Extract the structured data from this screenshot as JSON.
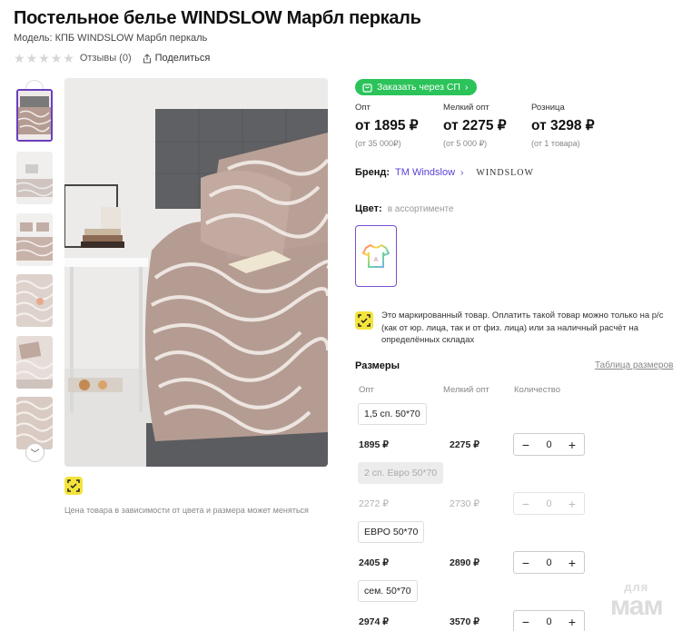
{
  "product": {
    "title": "Постельное белье WINDSLOW Марбл перкаль",
    "model": "Модель: КПБ WINDSLOW Марбл перкаль",
    "reviews": "Отзывы (0)",
    "share": "Поделиться",
    "rating_stars": 5,
    "price_note": "Цена товара в зависимости от цвета и размера может меняться"
  },
  "sp_button": "Заказать через СП",
  "prices": [
    {
      "label": "Опт",
      "value": "от 1895 ₽",
      "min": "(от 35 000₽)"
    },
    {
      "label": "Мелкий опт",
      "value": "от 2275 ₽",
      "min": "(от 5 000 ₽)"
    },
    {
      "label": "Розница",
      "value": "от 3298 ₽",
      "min": "(от 1 товара)"
    }
  ],
  "brand": {
    "label": "Бренд:",
    "name": "TM Windslow",
    "logo_text": "WINDSLOW"
  },
  "color": {
    "label": "Цвет:",
    "value": "в ассортименте"
  },
  "marked_text": "Это маркированный товар. Оплатить такой товар можно только на р/с (как от юр. лица, так и от физ. лица) или за наличный расчёт на определённых складах",
  "sizes": {
    "title": "Размеры",
    "table_link": "Таблица размеров",
    "col_opt": "Опт",
    "col_small_opt": "Мелкий опт",
    "col_qty": "Количество",
    "rows": [
      {
        "name": "1,5 сп. 50*70",
        "opt": "1895 ₽",
        "small_opt": "2275 ₽",
        "qty": "0",
        "disabled": false
      },
      {
        "name": "2 сп. Евро 50*70",
        "opt": "2272 ₽",
        "small_opt": "2730 ₽",
        "qty": "0",
        "disabled": true
      },
      {
        "name": "ЕВРО 50*70",
        "opt": "2405 ₽",
        "small_opt": "2890 ₽",
        "qty": "0",
        "disabled": false
      },
      {
        "name": "сем. 50*70",
        "opt": "2974 ₽",
        "small_opt": "3570 ₽",
        "qty": "0",
        "disabled": false
      }
    ]
  },
  "watermark": {
    "line1": "для",
    "line2": "мам"
  },
  "colors": {
    "accent": "#6a3fbf",
    "green": "#2bc35a",
    "mark_yellow": "#f3e33c",
    "link": "#5b3fd6"
  }
}
